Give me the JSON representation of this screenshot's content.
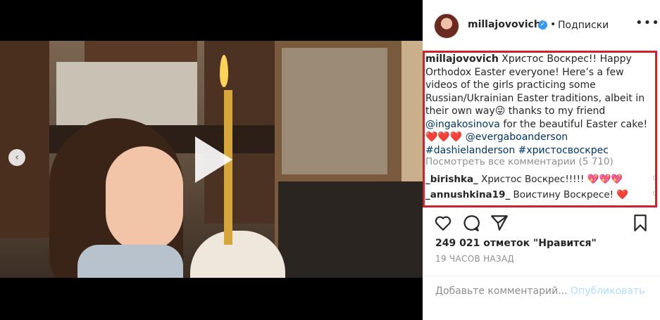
{
  "post": {
    "username": "millajovovich",
    "dot": "•",
    "follow_label": "Подписки",
    "more_label": "•••"
  },
  "caption": {
    "author": "millajovovich",
    "text1": " Христос Воскрес!! Happy Orthodox Easter everyone! Here’s a few videos of the girls practicing some Russian/Ukrainian Easter traditions, albeit in their own way😜 thanks to my friend ",
    "mention1": "@ingakosinova",
    "text2": " for the beautiful Easter cake!❤️❤️❤️ ",
    "mention2": "@evergaboanderson",
    "hashtag1": "#dashielanderson",
    "hashtag2": "#христосвоскрес"
  },
  "view_all": "Посмотреть все комментарии (5 710)",
  "comments": [
    {
      "user": "_birishka_",
      "text": " Христос Воскрес!!!!! 💖💖💖"
    },
    {
      "user": "_annushkina19_",
      "text": " Воистину Воскресе! ❤️"
    }
  ],
  "likes_text": "249 021 отметок \"Нравится\"",
  "time_ago": "19 ЧАСОВ НАЗАД",
  "comment_box": {
    "placeholder": "Добавьте комментарий...",
    "publish_label": "Опубликовать"
  },
  "colors": {
    "highlight_border": "#d0202e",
    "link": "#003569",
    "verified": "#3897f0"
  },
  "icons": [
    "play-icon",
    "prev-arrow-icon",
    "heart-icon",
    "comment-icon",
    "share-icon",
    "bookmark-icon",
    "verified-icon",
    "more-icon"
  ]
}
